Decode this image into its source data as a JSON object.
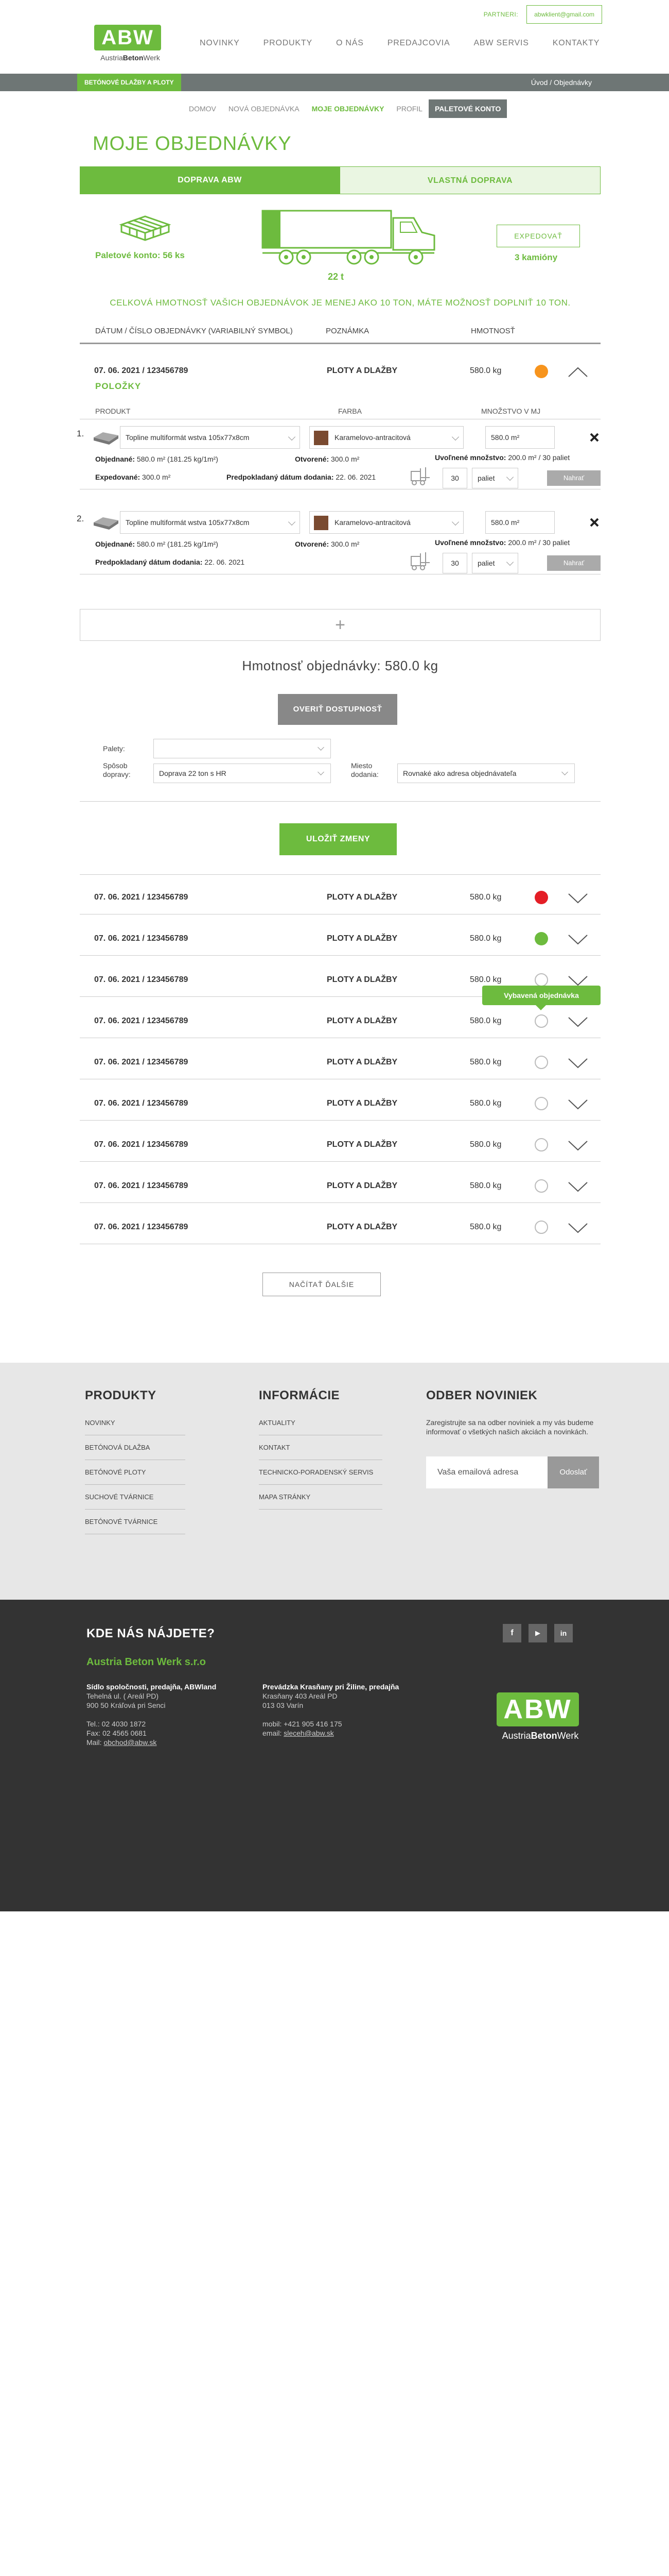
{
  "header": {
    "partner_link": "PARTNERI:",
    "email_button": "abwklient@gmail.com",
    "logo_text": "ABW",
    "logo_sub_a": "Austria",
    "logo_sub_b": "Beton",
    "logo_sub_c": "Werk",
    "nav": [
      "NOVINKY",
      "PRODUKTY",
      "O NÁS",
      "PREDAJCOVIA",
      "ABW SERVIS",
      "KONTAKTY"
    ]
  },
  "bar": {
    "category": "BETÓNOVÉ DLAŽBY A PLOTY",
    "breadcrumb": "Úvod  /  Objednávky"
  },
  "subnav": [
    "DOMOV",
    "NOVÁ OBJEDNÁVKA",
    "MOJE OBJEDNÁVKY",
    "PROFIL",
    "PALETOVÉ KONTO"
  ],
  "page_title": "MOJE OBJEDNÁVKY",
  "tabs": [
    "DOPRAVA ABW",
    "VLASTNÁ DOPRAVA"
  ],
  "summary": {
    "pallet_account": "Paletové konto: 56 ks",
    "tons": "22 t",
    "expedite_button": "EXPEDOVAŤ",
    "trucks": "3 kamióny",
    "truck_fill_fraction": 0.14,
    "notice": "CELKOVÁ HMOTNOSŤ VAŠICH OBJEDNÁVOK JE MENEJ AKO 10 TON, MÁTE MOŽNOSŤ DOPLNIŤ 10 TON."
  },
  "table_header": {
    "date": "DÁTUM / ČÍSLO OBJEDNÁVKY (VARIABILNÝ SYMBOL)",
    "note": "POZNÁMKA",
    "weight": "HMOTNOSŤ"
  },
  "open_order": {
    "date": "07. 06. 2021 / 123456789",
    "category": "PLOTY A DLAŽBY",
    "weight": "580.0 kg",
    "status_color": "#f7941d",
    "items_title": "POLOŽKY",
    "items_header": [
      "PRODUKT",
      "FARBA",
      "MNOŽSTVO V MJ"
    ],
    "items": [
      {
        "num": "1.",
        "product": "Topline multiformát wstva 105x77x8cm",
        "color": "Karamelovo-antracitová",
        "qty": "580.0 m²",
        "released_label": "Uvoľnené množstvo:",
        "released_value": "200.0 m² / 30 paliet",
        "ordered_label": "Objednané:",
        "ordered_value": "580.0 m² (181.25 kg/1m²)",
        "opened_label": "Otvorené:",
        "opened_value": "300.0 m²",
        "shipped_label": "Expedované:",
        "shipped_value": "300.0 m²",
        "date_label": "Predpokladaný dátum dodania:",
        "date_value": "22. 06. 2021",
        "pallet_count": "30",
        "pallet_unit": "paliet",
        "release_button": "Nahrať",
        "remove_icon": "close-icon"
      },
      {
        "num": "2.",
        "product": "Topline multiformát wstva 105x77x8cm",
        "color": "Karamelovo-antracitová",
        "qty": "580.0 m²",
        "released_label": "Uvoľnené množstvo:",
        "released_value": "200.0 m² / 30 paliet",
        "ordered_label": "Objednané:",
        "ordered_value": "580.0 m² (181.25 kg/1m²)",
        "opened_label": "Otvorené:",
        "opened_value": "300.0 m²",
        "shipped_label": "",
        "shipped_value": "",
        "date_label": "Predpokladaný dátum dodania:",
        "date_value": "22. 06. 2021",
        "pallet_count": "30",
        "pallet_unit": "paliet",
        "release_button": "Nahrať",
        "remove_icon": "close-icon"
      }
    ],
    "add_symbol": "+",
    "total_weight": "Hmotnosť objednávky: 580.0 kg",
    "verify_button": "OVERIŤ DOSTUPNOSŤ",
    "pallets_label": "Palety:",
    "pallets_value": "",
    "transport_label_1": "Spôsob",
    "transport_label_2": "dopravy:",
    "transport_value": "Doprava 22 ton s HR",
    "place_label_1": "Miesto",
    "place_label_2": "dodania:",
    "place_value": "Rovnaké ako adresa objednávateľa",
    "save_button": "ULOŽIŤ ZMENY"
  },
  "orders": [
    {
      "date": "07. 06. 2021 / 123456789",
      "category": "PLOTY A DLAŽBY",
      "weight": "580.0 kg",
      "status": "red",
      "status_color": "#e41e26"
    },
    {
      "date": "07. 06. 2021 / 123456789",
      "category": "PLOTY A DLAŽBY",
      "weight": "580.0 kg",
      "status": "green",
      "status_color": "#6dbb3e"
    },
    {
      "date": "07. 06. 2021 / 123456789",
      "category": "PLOTY A DLAŽBY",
      "weight": "580.0 kg",
      "status": "empty",
      "status_color": ""
    },
    {
      "date": "07. 06. 2021 / 123456789",
      "category": "PLOTY A DLAŽBY",
      "weight": "580.0 kg",
      "status": "empty",
      "status_color": ""
    },
    {
      "date": "07. 06. 2021 / 123456789",
      "category": "PLOTY A DLAŽBY",
      "weight": "580.0 kg",
      "status": "empty",
      "status_color": ""
    },
    {
      "date": "07. 06. 2021 / 123456789",
      "category": "PLOTY A DLAŽBY",
      "weight": "580.0 kg",
      "status": "empty",
      "status_color": ""
    },
    {
      "date": "07. 06. 2021 / 123456789",
      "category": "PLOTY A DLAŽBY",
      "weight": "580.0 kg",
      "status": "empty",
      "status_color": ""
    },
    {
      "date": "07. 06. 2021 / 123456789",
      "category": "PLOTY A DLAŽBY",
      "weight": "580.0 kg",
      "status": "empty",
      "status_color": ""
    },
    {
      "date": "07. 06. 2021 / 123456789",
      "category": "PLOTY A DLAŽBY",
      "weight": "580.0 kg",
      "status": "empty",
      "status_color": ""
    }
  ],
  "tooltip": "Vybavená objednávka",
  "load_more": "NAČÍTAŤ ĎALŠIE",
  "footer": {
    "products_title": "PRODUKTY",
    "products": [
      "NOVINKY",
      "BETÓNOVÁ DLAŽBA",
      "BETÓNOVÉ PLOTY",
      "SUCHOVÉ TVÁRNICE",
      "BETÓNOVÉ TVÁRNICE"
    ],
    "info_title": "INFORMÁCIE",
    "info": [
      "AKTUALITY",
      "KONTAKT",
      "TECHNICKO-PORADENSKÝ SERVIS",
      "MAPA STRÁNKY"
    ],
    "news_title": "ODBER NOVINIEK",
    "news_text": "Zaregistrujte sa na odber noviniek a my vás budeme informovať o všetkých našich akciách a novinkách.",
    "news_placeholder": "Vaša emailová adresa",
    "news_button": "Odoslať",
    "where_title": "KDE NÁS NÁJDETE?",
    "company": "Austria Beton Werk s.r.o",
    "col1": {
      "title": "Sídlo spoločnosti, predajňa, ABWland",
      "line1": "Tehelná ul. ( Areál PD)",
      "line2": "900 50 Kráľová pri Senci",
      "tel": "Tel.: 02 4030 1872",
      "fax": "Fax: 02 4565 0681",
      "mail_label": "Mail: ",
      "mail": "obchod@abw.sk"
    },
    "col2": {
      "title": "Prevádzka Krasňany pri Žiline, predajňa",
      "line1": "Krasňany 403 Areál PD",
      "line2": "013 03 Varín",
      "mobil": "mobil: +421 905 416 175",
      "email_label": "email: ",
      "email": "sleceh@abw.sk"
    },
    "social": [
      "f",
      "▶",
      "in"
    ],
    "logo_text": "ABW",
    "logo_sub_a": "Austria",
    "logo_sub_b": "Beton",
    "logo_sub_c": "Werk"
  }
}
